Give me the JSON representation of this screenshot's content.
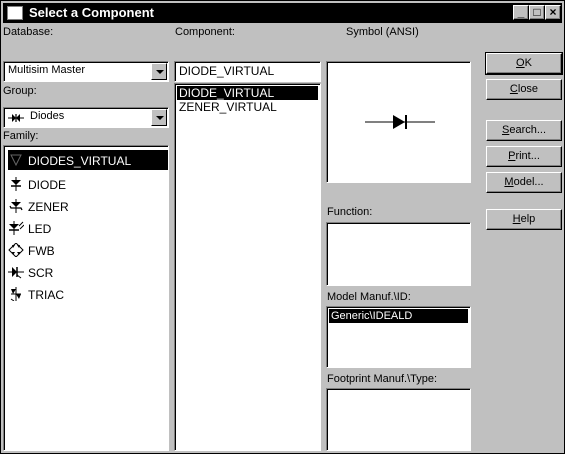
{
  "window": {
    "title": "Select a Component"
  },
  "titlebar_buttons": {
    "minimize": "_",
    "maximize": "□",
    "close": "×"
  },
  "database": {
    "label": "Database:",
    "value": "Multisim Master"
  },
  "group": {
    "label": "Group:",
    "value": "Diodes"
  },
  "family": {
    "label": "Family:",
    "items": [
      {
        "label": "DIODES_VIRTUAL",
        "icon": "diode-virtual-icon"
      },
      {
        "label": "DIODE",
        "icon": "diode-icon"
      },
      {
        "label": "ZENER",
        "icon": "zener-icon"
      },
      {
        "label": "LED",
        "icon": "led-icon"
      },
      {
        "label": "FWB",
        "icon": "bridge-icon"
      },
      {
        "label": "SCR",
        "icon": "scr-icon"
      },
      {
        "label": "TRIAC",
        "icon": "triac-icon"
      }
    ],
    "selected_index": 0
  },
  "component": {
    "label": "Component:",
    "value": "DIODE_VIRTUAL",
    "items": [
      "DIODE_VIRTUAL",
      "ZENER_VIRTUAL"
    ],
    "selected_index": 0
  },
  "symbol": {
    "label": "Symbol (ANSI)",
    "icon": "diode-symbol-icon"
  },
  "function": {
    "label": "Function:"
  },
  "model_manuf": {
    "label": "Model Manuf.\\ID:",
    "items": [
      "Generic\\IDEALD"
    ]
  },
  "footprint": {
    "label": "Footprint Manuf.\\Type:"
  },
  "buttons": {
    "ok": {
      "mnemonic": "O",
      "rest": "K"
    },
    "close": {
      "mnemonic": "C",
      "rest": "lose"
    },
    "search": {
      "mnemonic": "S",
      "rest": "earch..."
    },
    "print": {
      "mnemonic": "P",
      "rest": "rint..."
    },
    "model": {
      "mnemonic": "M",
      "rest": "odel..."
    },
    "help": {
      "mnemonic": "H",
      "rest": "elp"
    }
  }
}
